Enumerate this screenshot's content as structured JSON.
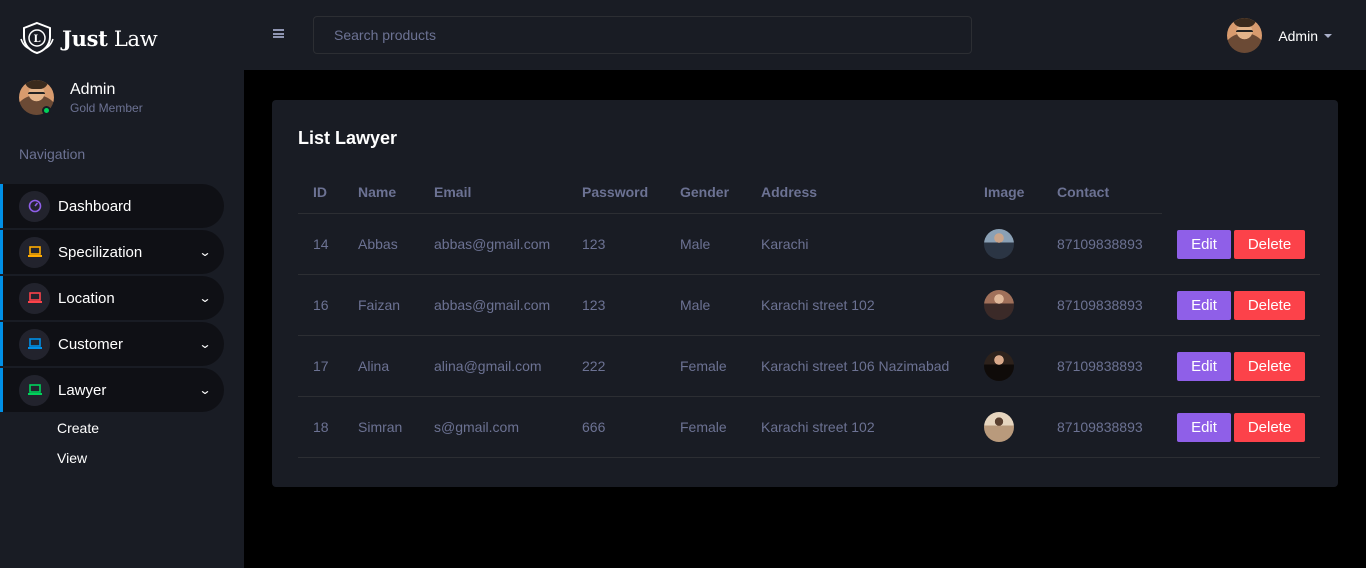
{
  "brand": {
    "bold": "Just",
    "light": " Law"
  },
  "profile": {
    "name": "Admin",
    "role": "Gold Member"
  },
  "nav": {
    "caption": "Navigation",
    "items": [
      {
        "label": "Dashboard",
        "icon": "speedometer-icon",
        "color": "#8f5fe8"
      },
      {
        "label": "Specilization",
        "icon": "laptop-icon",
        "color": "#ffab00"
      },
      {
        "label": "Location",
        "icon": "laptop-icon",
        "color": "#fc424a"
      },
      {
        "label": "Customer",
        "icon": "laptop-icon",
        "color": "#0090e7"
      },
      {
        "label": "Lawyer",
        "icon": "laptop-icon",
        "color": "#00d25b"
      }
    ],
    "sub_items": [
      {
        "label": "Create"
      },
      {
        "label": "View"
      }
    ]
  },
  "topbar": {
    "search_placeholder": "Search products",
    "user_name": "Admin"
  },
  "card": {
    "title": "List Lawyer",
    "columns": [
      "ID",
      "Name",
      "Email",
      "Password",
      "Gender",
      "Address",
      "Image",
      "Contact"
    ],
    "rows": [
      {
        "id": "14",
        "name": "Abbas",
        "email": "abbas@gmail.com",
        "password": "123",
        "gender": "Male",
        "address": "Karachi",
        "contact": "87109838893"
      },
      {
        "id": "16",
        "name": "Faizan",
        "email": "abbas@gmail.com",
        "password": "123",
        "gender": "Male",
        "address": "Karachi street 102",
        "contact": "87109838893"
      },
      {
        "id": "17",
        "name": "Alina",
        "email": "alina@gmail.com",
        "password": "222",
        "gender": "Female",
        "address": "Karachi street 106 Nazimabad",
        "contact": "87109838893"
      },
      {
        "id": "18",
        "name": "Simran",
        "email": "s@gmail.com",
        "password": "666",
        "gender": "Female",
        "address": "Karachi street 102",
        "contact": "87109838893"
      }
    ],
    "edit_label": "Edit",
    "delete_label": "Delete"
  },
  "colors": {
    "edit": "#8f5fe8",
    "delete": "#fc424a",
    "accent": "#0090e7",
    "online": "#00d25b"
  }
}
